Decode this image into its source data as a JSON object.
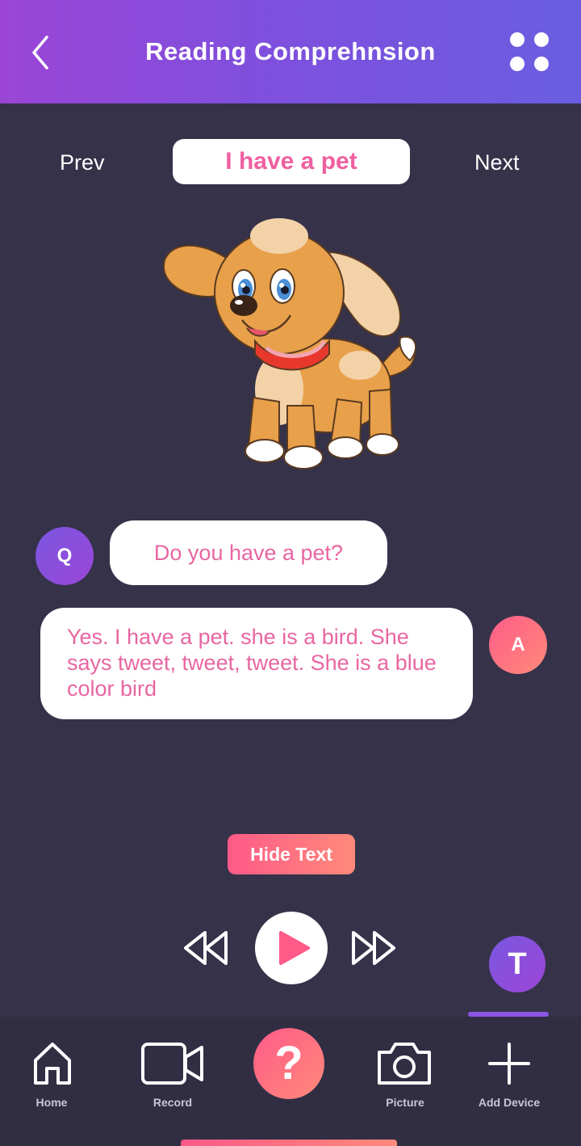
{
  "header": {
    "title": "Reading Comprehnsion",
    "back_icon": "chevron-left-icon",
    "menu_icon": "grid-dots-icon"
  },
  "lesson_nav": {
    "prev_label": "Prev",
    "current_title": "I have a pet",
    "next_label": "Next"
  },
  "illustration": {
    "subject": "puppy-icon"
  },
  "conversation": {
    "question": {
      "avatar_letter": "Q",
      "text": "Do you have a pet?"
    },
    "answer": {
      "avatar_letter": "A",
      "text": "Yes. I have a pet. she is a bird. She says tweet, tweet, tweet. She is a blue color bird"
    }
  },
  "controls": {
    "hide_text_label": "Hide Text",
    "rewind_icon": "rewind-icon",
    "play_icon": "play-icon",
    "forward_icon": "fast-forward-icon"
  },
  "floating": {
    "teacher_letter": "T"
  },
  "bottom_nav": {
    "items": [
      {
        "label": "Home",
        "icon": "home-icon"
      },
      {
        "label": "Record",
        "icon": "video-camera-icon"
      },
      {
        "label": "",
        "icon": "help-icon",
        "glyph": "?"
      },
      {
        "label": "Picture",
        "icon": "camera-icon"
      },
      {
        "label": "Add Device",
        "icon": "plus-icon"
      }
    ]
  },
  "colors": {
    "header_start": "#9b45d6",
    "header_end": "#6a5ee0",
    "background": "#35324a",
    "accent_pink": "#ef5fa0",
    "accent_coral": "#ff8a7a",
    "accent_purple": "#7a58e0"
  }
}
